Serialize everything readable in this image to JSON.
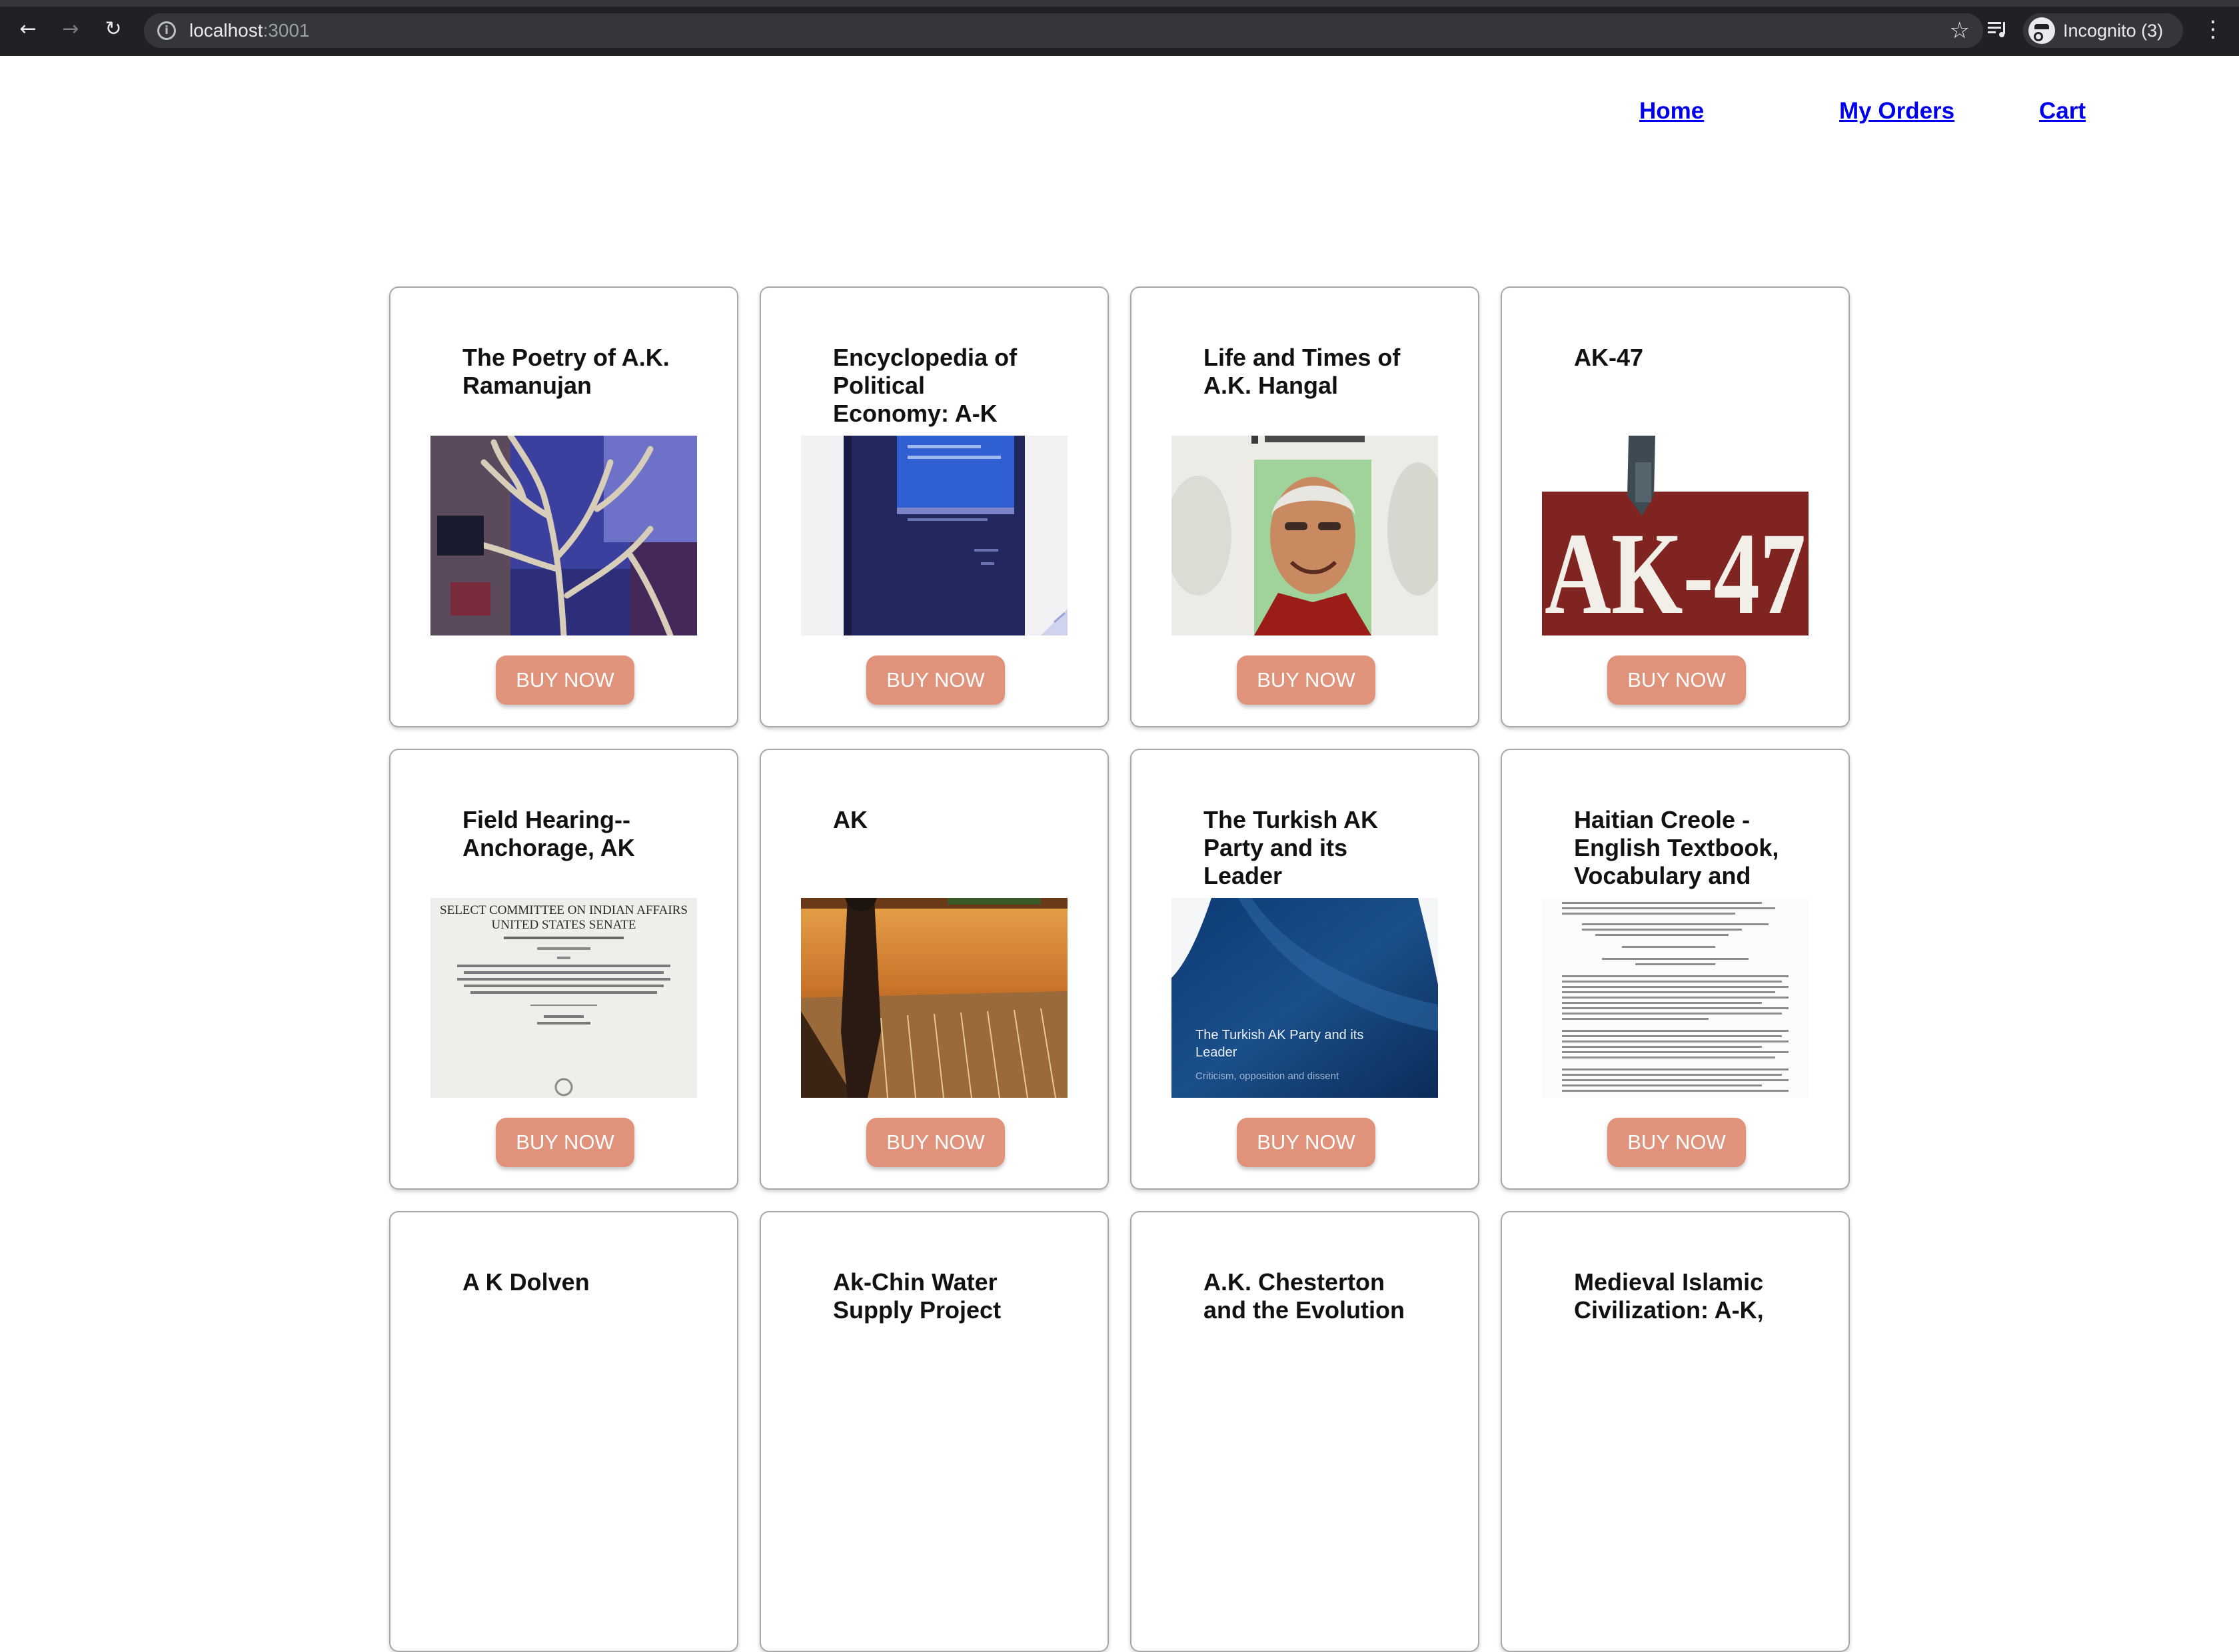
{
  "browser": {
    "url_host": "localhost",
    "url_port": ":3001",
    "incognito_label": "Incognito (3)",
    "icons": [
      "back-arrow-icon",
      "forward-arrow-icon",
      "reload-icon",
      "info-icon",
      "star-icon",
      "media-queue-icon",
      "incognito-icon",
      "kebab-menu-icon"
    ]
  },
  "nav": {
    "home": "Home",
    "orders": "My Orders",
    "cart": "Cart"
  },
  "books": [
    {
      "title": "The Poetry of A.K. Ramanujan",
      "button": "BUY NOW"
    },
    {
      "title": "Encyclopedia of Political Economy: A-K",
      "button": "BUY NOW"
    },
    {
      "title": "Life and Times of A.K. Hangal",
      "button": "BUY NOW"
    },
    {
      "title": "AK-47",
      "button": "BUY NOW",
      "cover_text": "AK-47"
    },
    {
      "title": "Field Hearing--Anchorage, AK",
      "button": "BUY NOW",
      "cover_text": [
        "SELECT COMMITTEE ON INDIAN AFFAIRS",
        "UNITED STATES SENATE"
      ]
    },
    {
      "title": "AK",
      "button": "BUY NOW"
    },
    {
      "title": "The Turkish AK Party and its Leader",
      "button": "BUY NOW",
      "cover_text": [
        "The Turkish AK Party and its",
        "Leader",
        "Criticism, opposition and dissent"
      ]
    },
    {
      "title": "Haitian Creole - English Textbook, Vocabulary and",
      "button": "BUY NOW"
    },
    {
      "title": "A K Dolven"
    },
    {
      "title": "Ak-Chin Water Supply Project"
    },
    {
      "title": "A.K. Chesterton and the Evolution"
    },
    {
      "title": "Medieval Islamic Civilization: A-K,"
    }
  ],
  "colors": {
    "button": "#e0927a",
    "link": "#0000ee",
    "card_border": "#a8a8a8",
    "chrome": "#202124"
  }
}
